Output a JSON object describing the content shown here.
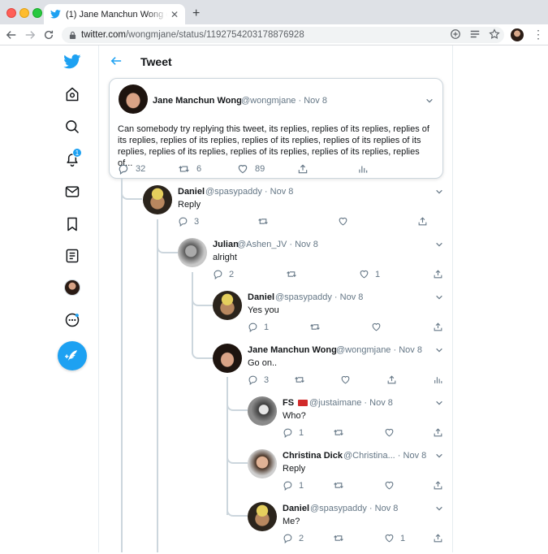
{
  "browser": {
    "tab_title": "(1) Jane Manchun Wong on Twitter",
    "url_host": "twitter.com",
    "url_path": "/wongmjane/status/1192754203178876928"
  },
  "sidebar": {
    "notification_count": "1",
    "items": [
      "twitter-logo",
      "home-icon",
      "explore-icon",
      "notifications-icon",
      "messages-icon",
      "bookmarks-icon",
      "lists-icon",
      "profile-avatar",
      "more-icon"
    ]
  },
  "header": {
    "title": "Tweet"
  },
  "focus_tweet": {
    "name": "Jane Manchun Wong",
    "handle": "@wongmjane",
    "date": "Nov 8",
    "text": "Can somebody try replying this tweet, its replies, replies of its replies, replies of its replies, replies of its replies, replies of its replies, replies of its replies of its replies, replies of its replies, replies of its replies, replies of its replies, replies of...",
    "replies": "32",
    "retweets": "6",
    "likes": "89"
  },
  "replies": [
    {
      "name": "Daniel",
      "handle": "@spasypaddy",
      "date": "Nov 8",
      "text": "Reply",
      "replies": "3",
      "retweets": "",
      "likes": ""
    },
    {
      "name": "Julian",
      "handle": "@Ashen_JV",
      "date": "Nov 8",
      "text": "alright",
      "replies": "2",
      "retweets": "",
      "likes": "1"
    },
    {
      "name": "Daniel",
      "handle": "@spasypaddy",
      "date": "Nov 8",
      "text": "Yes you",
      "replies": "1",
      "retweets": "",
      "likes": ""
    },
    {
      "name": "Jane Manchun Wong",
      "handle": "@wongmjane",
      "date": "Nov 8",
      "text": "Go on..",
      "replies": "3",
      "retweets": "",
      "likes": ""
    },
    {
      "name": "FS",
      "handle": "@justaimane",
      "date": "Nov 8",
      "text": "Who?",
      "replies": "1",
      "retweets": "",
      "likes": ""
    },
    {
      "name": "Christina Dick",
      "handle": "@Christina...",
      "date": "Nov 8",
      "text": "Reply",
      "replies": "1",
      "retweets": "",
      "likes": ""
    },
    {
      "name": "Daniel",
      "handle": "@spasypaddy",
      "date": "Nov 8",
      "text": "Me?",
      "replies": "2",
      "retweets": "",
      "likes": "1"
    }
  ],
  "colors": {
    "accent": "#1da1f2",
    "text": "#14171a",
    "muted": "#657786",
    "border": "#e6ecf0"
  }
}
